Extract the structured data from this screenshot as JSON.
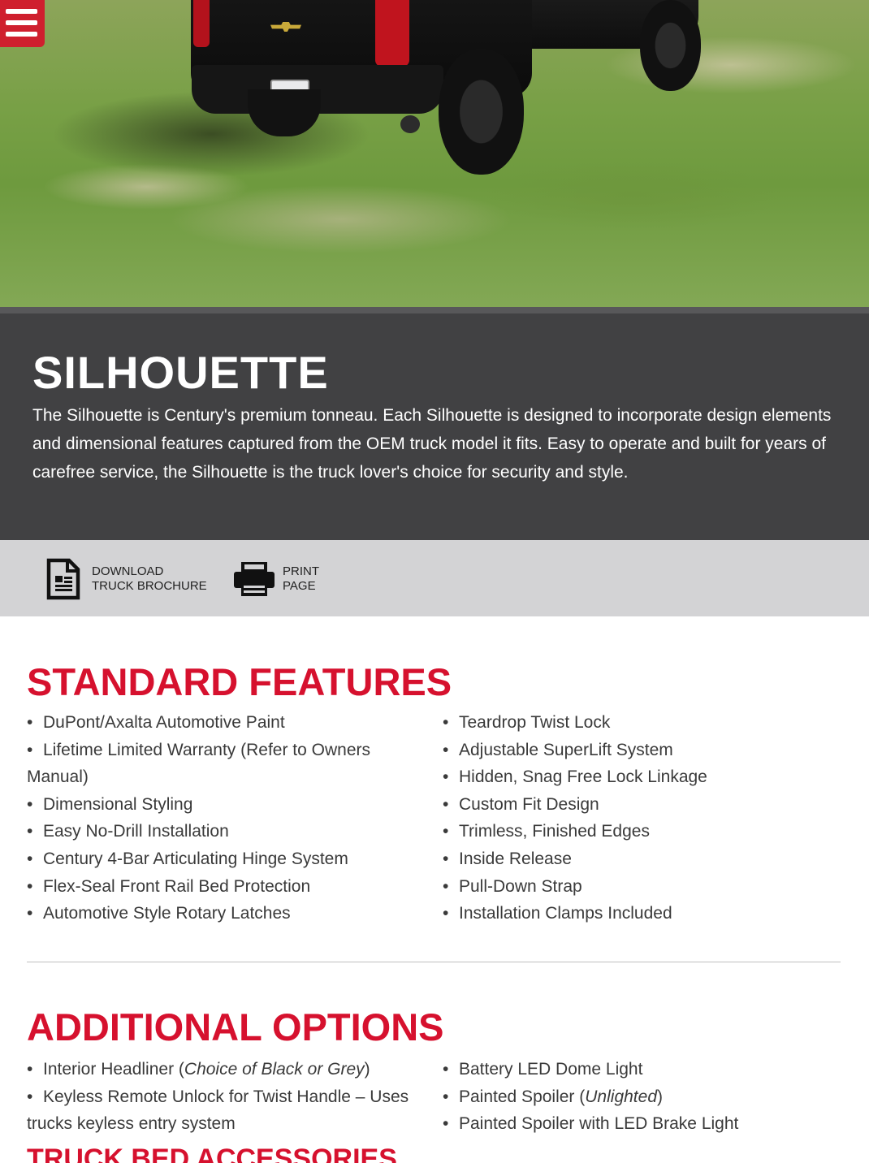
{
  "nav": {
    "menu_icon": "hamburger-menu-icon"
  },
  "hero": {
    "alt": "Truck rear with Silhouette tonneau on grass"
  },
  "product": {
    "title": "SILHOUETTE",
    "description": "The Silhouette is Century's premium tonneau. Each Silhouette is designed to incorporate design elements and dimensional features captured from the OEM truck model it fits. Easy to operate and built for years of carefree service, the Silhouette is the truck lover's choice for security and style."
  },
  "toolbar": {
    "download": {
      "line1": "DOWNLOAD",
      "line2": "TRUCK BROCHURE",
      "icon": "document-icon"
    },
    "print": {
      "line1": "PRINT",
      "line2": "PAGE",
      "icon": "printer-icon"
    }
  },
  "standard_features": {
    "title": "STANDARD FEATURES",
    "left": [
      "DuPont/Axalta Automotive Paint",
      "Lifetime Limited Warranty (Refer to Owners",
      "Manual)",
      "Dimensional Styling",
      "Easy No-Drill Installation",
      "Century 4-Bar Articulating Hinge System",
      "Flex-Seal Front Rail Bed Protection",
      "Automotive Style Rotary Latches"
    ],
    "right": [
      "Teardrop Twist Lock",
      "Adjustable SuperLift System",
      "Hidden, Snag Free Lock Linkage",
      "Custom Fit Design",
      "Trimless, Finished Edges",
      "Inside Release",
      "Pull-Down Strap",
      "Installation Clamps Included"
    ]
  },
  "additional_options": {
    "title": "ADDITIONAL OPTIONS",
    "left": [
      {
        "prefix": "Interior Headliner (",
        "italic": "Choice of Black or Grey",
        "suffix": ")"
      },
      {
        "prefix": "Keyless Remote Unlock for Twist Handle – Uses",
        "italic": "",
        "suffix": ""
      },
      {
        "prefix": "trucks keyless entry system",
        "italic": "",
        "suffix": ""
      }
    ],
    "right": [
      {
        "prefix": "Battery LED Dome Light",
        "italic": "",
        "suffix": ""
      },
      {
        "prefix": "Painted Spoiler (",
        "italic": "Unlighted",
        "suffix": ")"
      },
      {
        "prefix": "Painted Spoiler with LED Brake Light",
        "italic": "",
        "suffix": ""
      }
    ]
  },
  "truck_bed_accessories": {
    "title": "TRUCK BED ACCESSORIES"
  },
  "colors": {
    "accent_red": "#d6112e",
    "dark_panel": "#414143",
    "toolbar_grey": "#d3d3d5"
  }
}
